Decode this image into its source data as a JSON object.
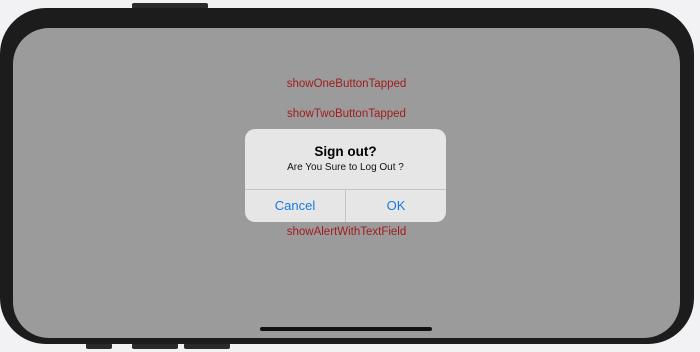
{
  "screen": {
    "actions": [
      {
        "label": "showOneButtonTapped"
      },
      {
        "label": "showTwoButtonTapped"
      },
      {
        "label": "showAlertWithTextField"
      }
    ]
  },
  "alert": {
    "title": "Sign out?",
    "message": "Are You Sure to Log Out ?",
    "cancel_label": "Cancel",
    "ok_label": "OK"
  },
  "colors": {
    "screen_dim": "#9b9b9b",
    "link_text": "#a11c1c",
    "alert_button": "#1a7ae0",
    "device_frame": "#1c1c1c"
  }
}
